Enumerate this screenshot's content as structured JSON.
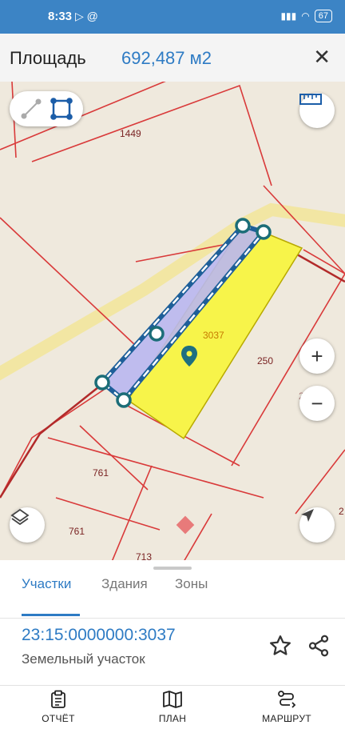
{
  "status_bar": {
    "time": "8:33",
    "left_icons": "▷ @",
    "battery": "67"
  },
  "header": {
    "title": "Площадь",
    "area_value": "692,487 м2",
    "close_icon": "close-icon"
  },
  "map": {
    "labels": [
      "1449",
      "3037",
      "250",
      "761",
      "761",
      "713",
      "298",
      "2"
    ],
    "controls": [
      "line-tool-icon",
      "polygon-tool-icon",
      "ruler-icon",
      "zoom-in-icon",
      "zoom-out-icon",
      "layers-icon",
      "location-arrow-icon"
    ],
    "colors": {
      "parcel_border": "#d93a3a",
      "road": "#f2e6a3",
      "selected_fill": "#f7f44a",
      "measure_fill": "#b9b7f0",
      "measure_line": "#1e5f99"
    }
  },
  "tabs": [
    {
      "label": "Участки",
      "active": true
    },
    {
      "label": "Здания",
      "active": false
    },
    {
      "label": "Зоны",
      "active": false
    }
  ],
  "parcel": {
    "cadastral_number": "23:15:0000000:3037",
    "type": "Земельный участок"
  },
  "actions": [
    "star-icon",
    "share-icon"
  ],
  "bottom_nav": [
    {
      "label": "ОТЧЁТ",
      "icon": "report-icon"
    },
    {
      "label": "ПЛАН",
      "icon": "map-plan-icon"
    },
    {
      "label": "МАРШРУТ",
      "icon": "route-icon"
    }
  ]
}
